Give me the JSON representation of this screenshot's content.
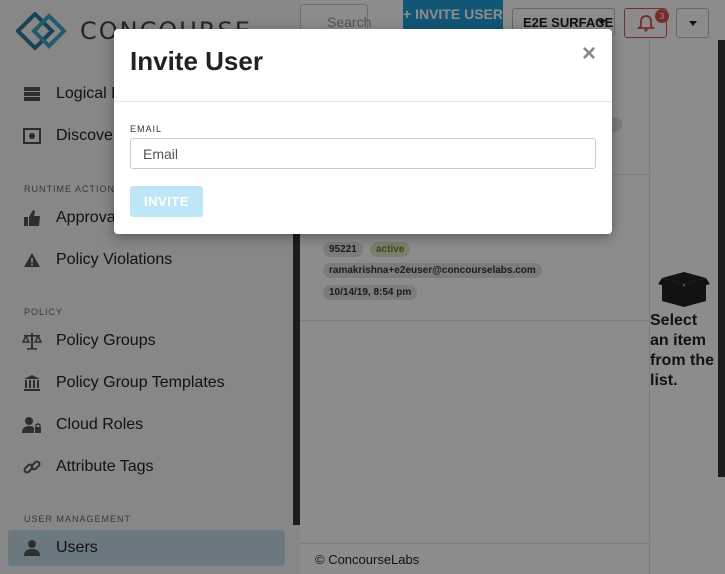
{
  "app": {
    "logo_text": "CONCOURSE",
    "brand_color": "#1f9dd6"
  },
  "sidebar": {
    "items_top": [
      {
        "label": "Logical Definitions",
        "icon": "server-icon"
      },
      {
        "label": "Discovery",
        "icon": "discovery-icon"
      }
    ],
    "sections": [
      {
        "label": "RUNTIME ACTIONS",
        "items": [
          {
            "label": "Approvals",
            "icon": "thumbs-up-icon"
          },
          {
            "label": "Policy Violations",
            "icon": "warning-icon"
          }
        ]
      },
      {
        "label": "POLICY",
        "items": [
          {
            "label": "Policy Groups",
            "icon": "scales-icon"
          },
          {
            "label": "Policy Group Templates",
            "icon": "bank-icon"
          },
          {
            "label": "Cloud Roles",
            "icon": "user-lock-icon"
          },
          {
            "label": "Attribute Tags",
            "icon": "link-icon"
          }
        ]
      },
      {
        "label": "USER MANAGEMENT",
        "items": [
          {
            "label": "Users",
            "icon": "user-icon",
            "active": true
          }
        ]
      }
    ]
  },
  "topbar": {
    "search_placeholder": "Search",
    "invite_label": "+ INVITE USER",
    "tenant": "E2E SURFACE",
    "notification_count": "3"
  },
  "list": {
    "item": {
      "id": "95221",
      "status": "active",
      "email": "ramakrishna+e2euser@concourselabs.com",
      "date": "10/14/19, 8:54 pm"
    }
  },
  "detail": {
    "empty_message": "Select an item from the list."
  },
  "footer": {
    "copyright": "© ConcourseLabs"
  },
  "modal": {
    "title": "Invite User",
    "close_label": "×",
    "email_label": "EMAIL",
    "email_placeholder": "Email",
    "email_value": "",
    "submit_label": "INVITE"
  }
}
